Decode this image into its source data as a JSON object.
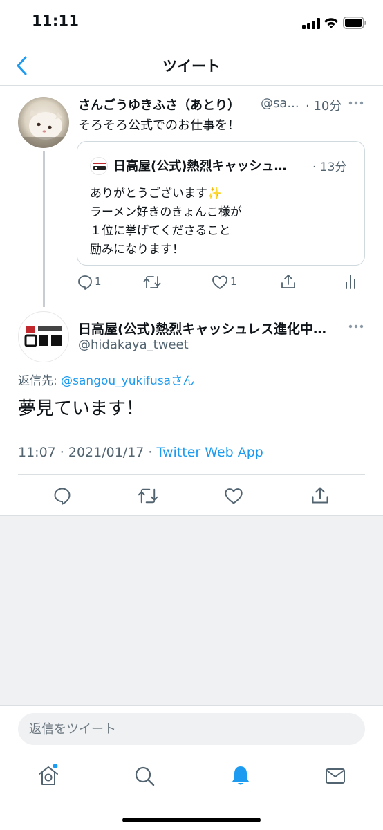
{
  "status_bar": {
    "time": "11:11"
  },
  "nav": {
    "title": "ツイート"
  },
  "parent_tweet": {
    "name": "さんごうゆきふさ（あとり）",
    "handle": "@sa...",
    "time": "· 10分",
    "text": "そろそろ公式でのお仕事を！",
    "quote": {
      "name": "日高屋(公式)熱烈キャッシュ…",
      "time": "· 13分",
      "lines": [
        "ありがとうございます✨",
        "ラーメン好きのきょんこ様が",
        "１位に挙げてくださること",
        "励みになります！"
      ]
    },
    "actions": {
      "reply_count": "1",
      "like_count": "1"
    }
  },
  "main_tweet": {
    "name": "日高屋(公式)熱烈キャッシュレス進化中…",
    "handle": "@hidakaya_tweet",
    "reply_to_label": "返信先: ",
    "reply_to_mention": "@sangou_yukifusa",
    "reply_to_suffix": "さん",
    "text": "夢見ています！",
    "datetime": "11:07 · 2021/01/17 · ",
    "source": "Twitter Web App"
  },
  "reply_box": {
    "placeholder": "返信をツイート"
  },
  "tab_bar": {
    "items": [
      "home-icon",
      "search-icon",
      "notifications-icon",
      "messages-icon"
    ]
  },
  "colors": {
    "accent": "#1d9bf0",
    "secondary_text": "#536471",
    "gray_area": "#f0f1f3"
  }
}
